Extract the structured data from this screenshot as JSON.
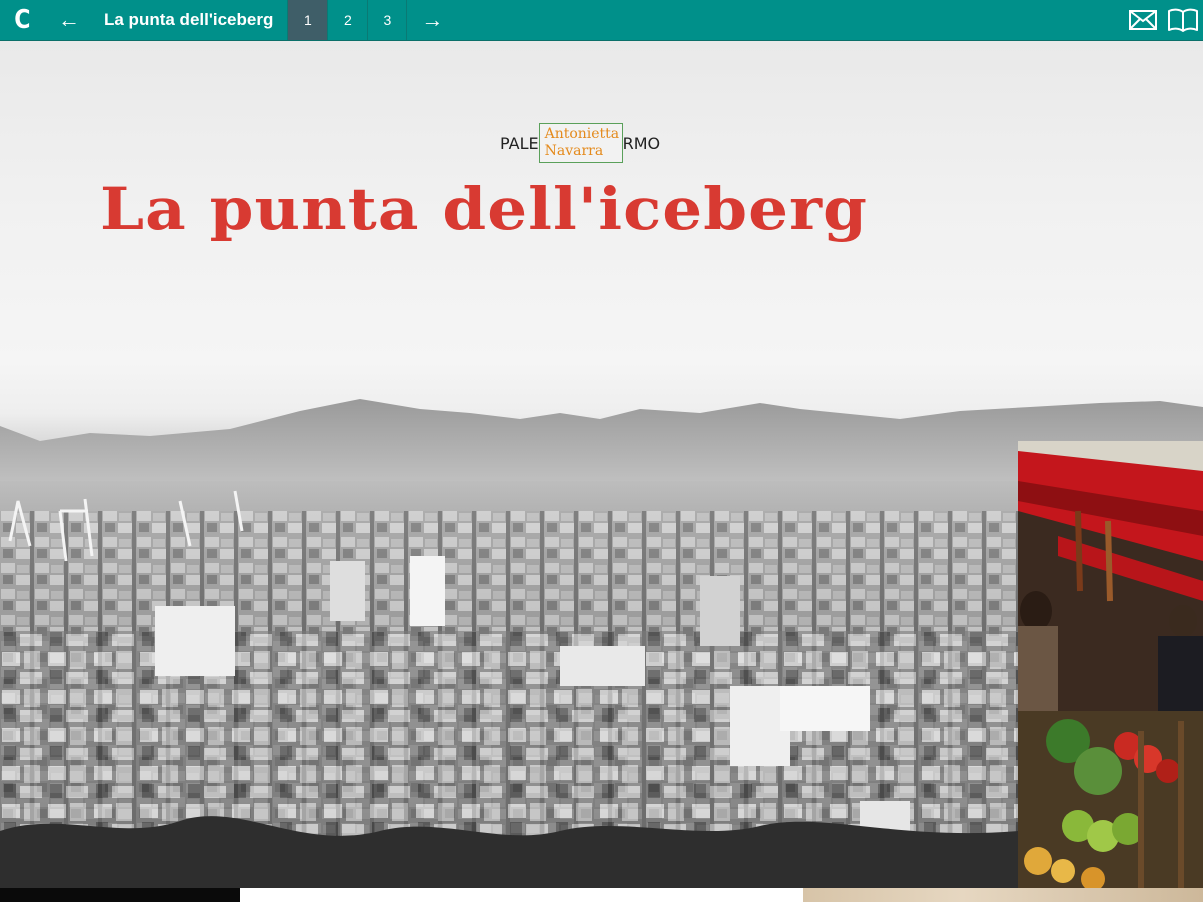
{
  "topbar": {
    "logo": "C",
    "prev_arrow": "←",
    "next_arrow": "→",
    "title": "La punta dell'iceberg",
    "pages": [
      "1",
      "2",
      "3"
    ],
    "active_page": "1",
    "icons": [
      "mail-icon",
      "book-icon"
    ]
  },
  "hero": {
    "location_left": "PALE",
    "location_right": "RMO",
    "author": "Antonietta Navarra",
    "headline": "La punta dell'iceberg"
  },
  "colors": {
    "bar": "#00908a",
    "active_page": "#3f5e68",
    "headline": "#d83a32",
    "author": "#e48a1c"
  }
}
